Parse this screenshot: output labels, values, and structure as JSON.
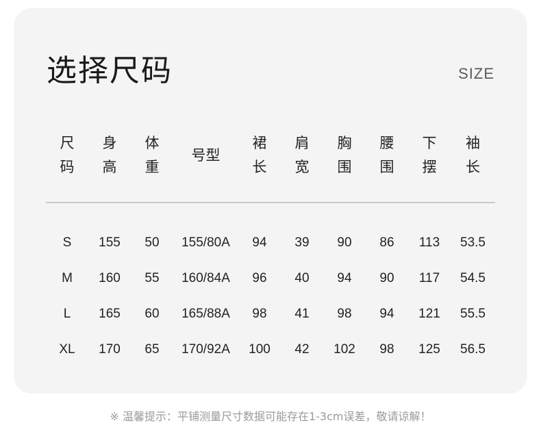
{
  "title": "选择尺码",
  "size_tag": "SIZE",
  "table": {
    "headers": [
      "尺码",
      "身高",
      "体重",
      "号型",
      "裙长",
      "肩宽",
      "胸围",
      "腰围",
      "下摆",
      "袖长"
    ],
    "rows": [
      [
        "S",
        "155",
        "50",
        "155/80A",
        "94",
        "39",
        "90",
        "86",
        "113",
        "53.5"
      ],
      [
        "M",
        "160",
        "55",
        "160/84A",
        "96",
        "40",
        "94",
        "90",
        "117",
        "54.5"
      ],
      [
        "L",
        "165",
        "60",
        "165/88A",
        "98",
        "41",
        "98",
        "94",
        "121",
        "55.5"
      ],
      [
        "XL",
        "170",
        "65",
        "170/92A",
        "100",
        "42",
        "102",
        "98",
        "125",
        "56.5"
      ]
    ]
  },
  "note": "※ 温馨提示：平铺测量尺寸数据可能存在1-3cm误差，敬请谅解！"
}
